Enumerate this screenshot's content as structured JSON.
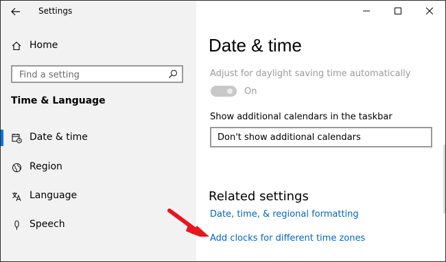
{
  "window": {
    "title": "Settings"
  },
  "sidebar": {
    "home_label": "Home",
    "search": {
      "placeholder": "Find a setting",
      "value": ""
    },
    "section_heading": "Time & Language",
    "items": [
      {
        "label": "Date & time",
        "icon": "calendar-clock-icon",
        "active": true
      },
      {
        "label": "Region",
        "icon": "globe-icon",
        "active": false
      },
      {
        "label": "Language",
        "icon": "language-icon",
        "active": false
      },
      {
        "label": "Speech",
        "icon": "microphone-icon",
        "active": false
      }
    ]
  },
  "main": {
    "title": "Date & time",
    "dst_label": "Adjust for daylight saving time automatically",
    "dst_state": "On",
    "calendars_label": "Show additional calendars in the taskbar",
    "calendars_selected": "Don't show additional calendars",
    "related_heading": "Related settings",
    "links": [
      "Date, time, & regional formatting",
      "Add clocks for different time zones"
    ]
  },
  "colors": {
    "accent": "#0078d7",
    "link": "#0067b8",
    "sidebar_bg": "#f2f2f2",
    "annotation_arrow": "#e8151d"
  }
}
